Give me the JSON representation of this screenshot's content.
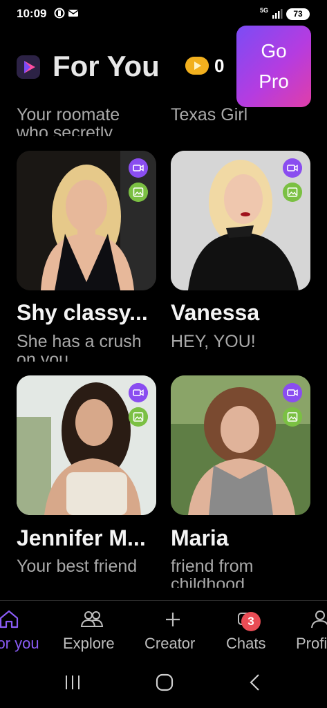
{
  "status_bar": {
    "time": "10:09",
    "network": "5G",
    "battery": "73",
    "icons": [
      "data-saver-icon",
      "mail-icon",
      "signal-icon",
      "battery-icon"
    ]
  },
  "header": {
    "title": "For You",
    "coins": "0",
    "go_pro_line1": "Go",
    "go_pro_line2": "Pro",
    "icons": [
      "app-logo-icon",
      "coin-icon"
    ]
  },
  "top_partial": {
    "left_desc": "Your roomate",
    "left_desc_cut": "who secretly",
    "right_desc": "Texas Girl"
  },
  "cards": [
    {
      "name": "Shy classy...",
      "desc": "She has a crush",
      "desc_cut": "on you",
      "colors": [
        "#1c1a17",
        "#e6c98a",
        "#0e0e12"
      ]
    },
    {
      "name": "Vanessa",
      "desc": "HEY, YOU!",
      "desc_cut": "",
      "colors": [
        "#cfcfcf",
        "#f1d9a4",
        "#111111"
      ]
    },
    {
      "name": "Jennifer M...",
      "desc": "Your best friend",
      "desc_cut": "",
      "colors": [
        "#dfe6e3",
        "#2a1c14",
        "#ece6da"
      ]
    },
    {
      "name": "Maria",
      "desc": "friend from",
      "desc_cut": "childhood",
      "colors": [
        "#6a8a4c",
        "#7a4a30",
        "#8a8a8a"
      ]
    }
  ],
  "nav": {
    "items": [
      {
        "label": "For you",
        "icon": "home-icon"
      },
      {
        "label": "Explore",
        "icon": "people-icon"
      },
      {
        "label": "Creator",
        "icon": "plus-icon"
      },
      {
        "label": "Chats",
        "icon": "chat-icon",
        "badge": "3"
      },
      {
        "label": "Profile",
        "icon": "profile-icon"
      }
    ],
    "active_color": "#8a5cf6"
  },
  "system_nav": [
    "recents-icon",
    "home-circle-icon",
    "back-icon"
  ]
}
